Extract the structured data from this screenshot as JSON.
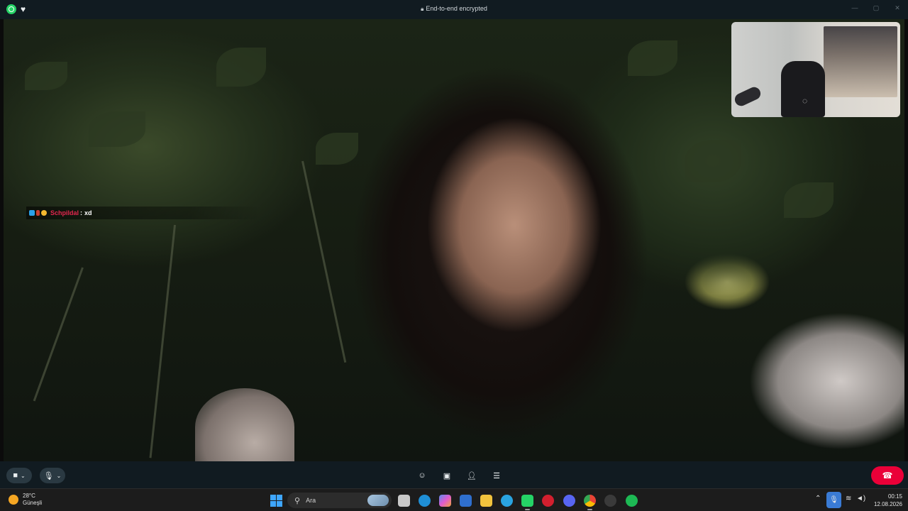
{
  "titlebar": {
    "encryption_text": "End-to-end encrypted"
  },
  "chat_overlay": {
    "username": "Schpildal",
    "separator": ":",
    "message": "xd"
  },
  "call_controls": {
    "items": [
      "video-camera-icon",
      "chevron-down-icon",
      "microphone-icon",
      "chevron-down-icon",
      "emoji-icon",
      "screen-share-icon",
      "add-person-icon",
      "more-options-icon"
    ],
    "end_call_color": "#ea0038"
  },
  "taskbar": {
    "weather": {
      "temperature": "28°C",
      "condition": "Güneşli"
    },
    "search_placeholder": "Ara",
    "clock": {
      "time": "00:15",
      "date": "12.08.2026"
    }
  },
  "colors": {
    "accent_whatsapp": "#25d366",
    "chat_username": "#e3264f",
    "windows_blue": "#3ea6ff"
  }
}
